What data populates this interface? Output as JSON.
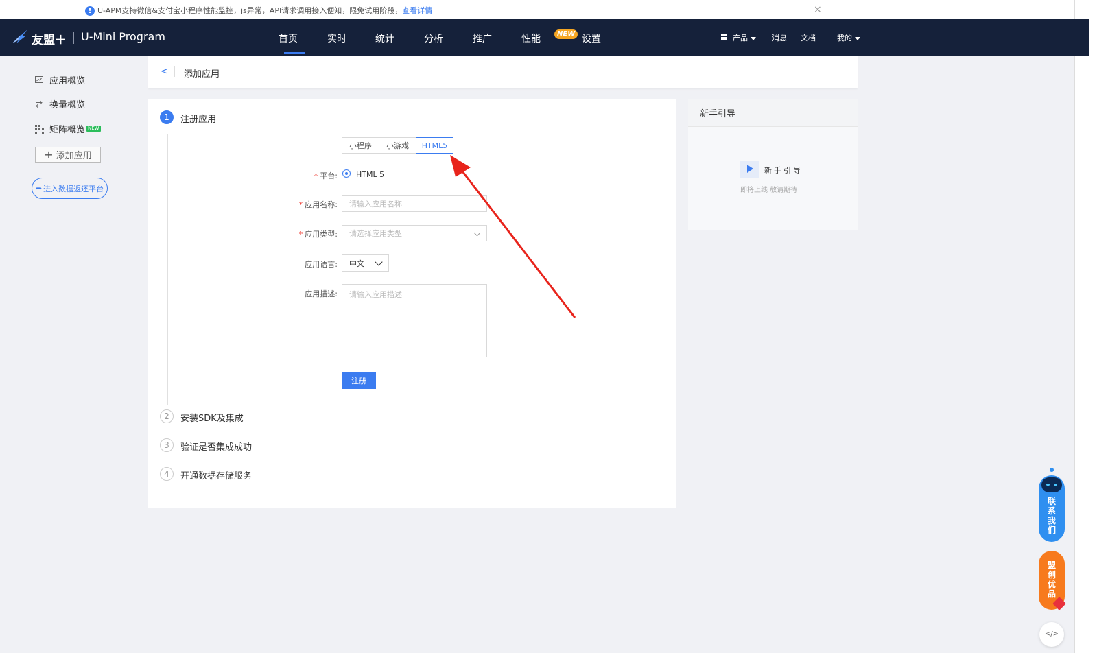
{
  "notice": {
    "text": "U-APM支持微信&支付宝小程序性能监控，js异常，API请求调用接入便知，限免试用阶段，",
    "link": "查看详情"
  },
  "header": {
    "brand": "友盟＋",
    "product": "U-Mini Program",
    "nav": [
      "首页",
      "实时",
      "统计",
      "分析",
      "推广",
      "性能",
      "设置"
    ],
    "active_nav": "首页",
    "perf_badge": "NEW",
    "right": {
      "products": "产品",
      "messages": "消息",
      "docs": "文档",
      "mine": "我的"
    }
  },
  "sidebar": {
    "items": [
      {
        "label": "应用概览",
        "icon": "chart-monitor-icon"
      },
      {
        "label": "换量概览",
        "icon": "swap-arrows-icon"
      },
      {
        "label": "矩阵概览",
        "icon": "matrix-grid-icon",
        "badge": "NEW"
      }
    ],
    "add_app": "添加应用",
    "enter_platform": "进入数据返还平台"
  },
  "page": {
    "title": "添加应用"
  },
  "steps": [
    {
      "num": "1",
      "label": "注册应用",
      "active": true
    },
    {
      "num": "2",
      "label": "安装SDK及集成",
      "active": false
    },
    {
      "num": "3",
      "label": "验证是否集成成功",
      "active": false
    },
    {
      "num": "4",
      "label": "开通数据存储服务",
      "active": false
    }
  ],
  "form": {
    "tabs": [
      "小程序",
      "小游戏",
      "HTML5"
    ],
    "active_tab": "HTML5",
    "platform_label": "平台",
    "platform_value": "HTML 5",
    "name_label": "应用名称",
    "name_placeholder": "请输入应用名称",
    "type_label": "应用类型",
    "type_placeholder": "请选择应用类型",
    "lang_label": "应用语言",
    "lang_value": "中文",
    "desc_label": "应用描述",
    "desc_placeholder": "请输入应用描述",
    "submit": "注册"
  },
  "guide": {
    "title": "新手引导",
    "label": "新手引导",
    "sub": "即将上线  敬请期待"
  },
  "float": {
    "contact": "联系我们",
    "promo": "盟创优品"
  },
  "colors": {
    "primary": "#3b7cf0",
    "header_bg": "#15213a",
    "arrow": "#e8241c"
  }
}
